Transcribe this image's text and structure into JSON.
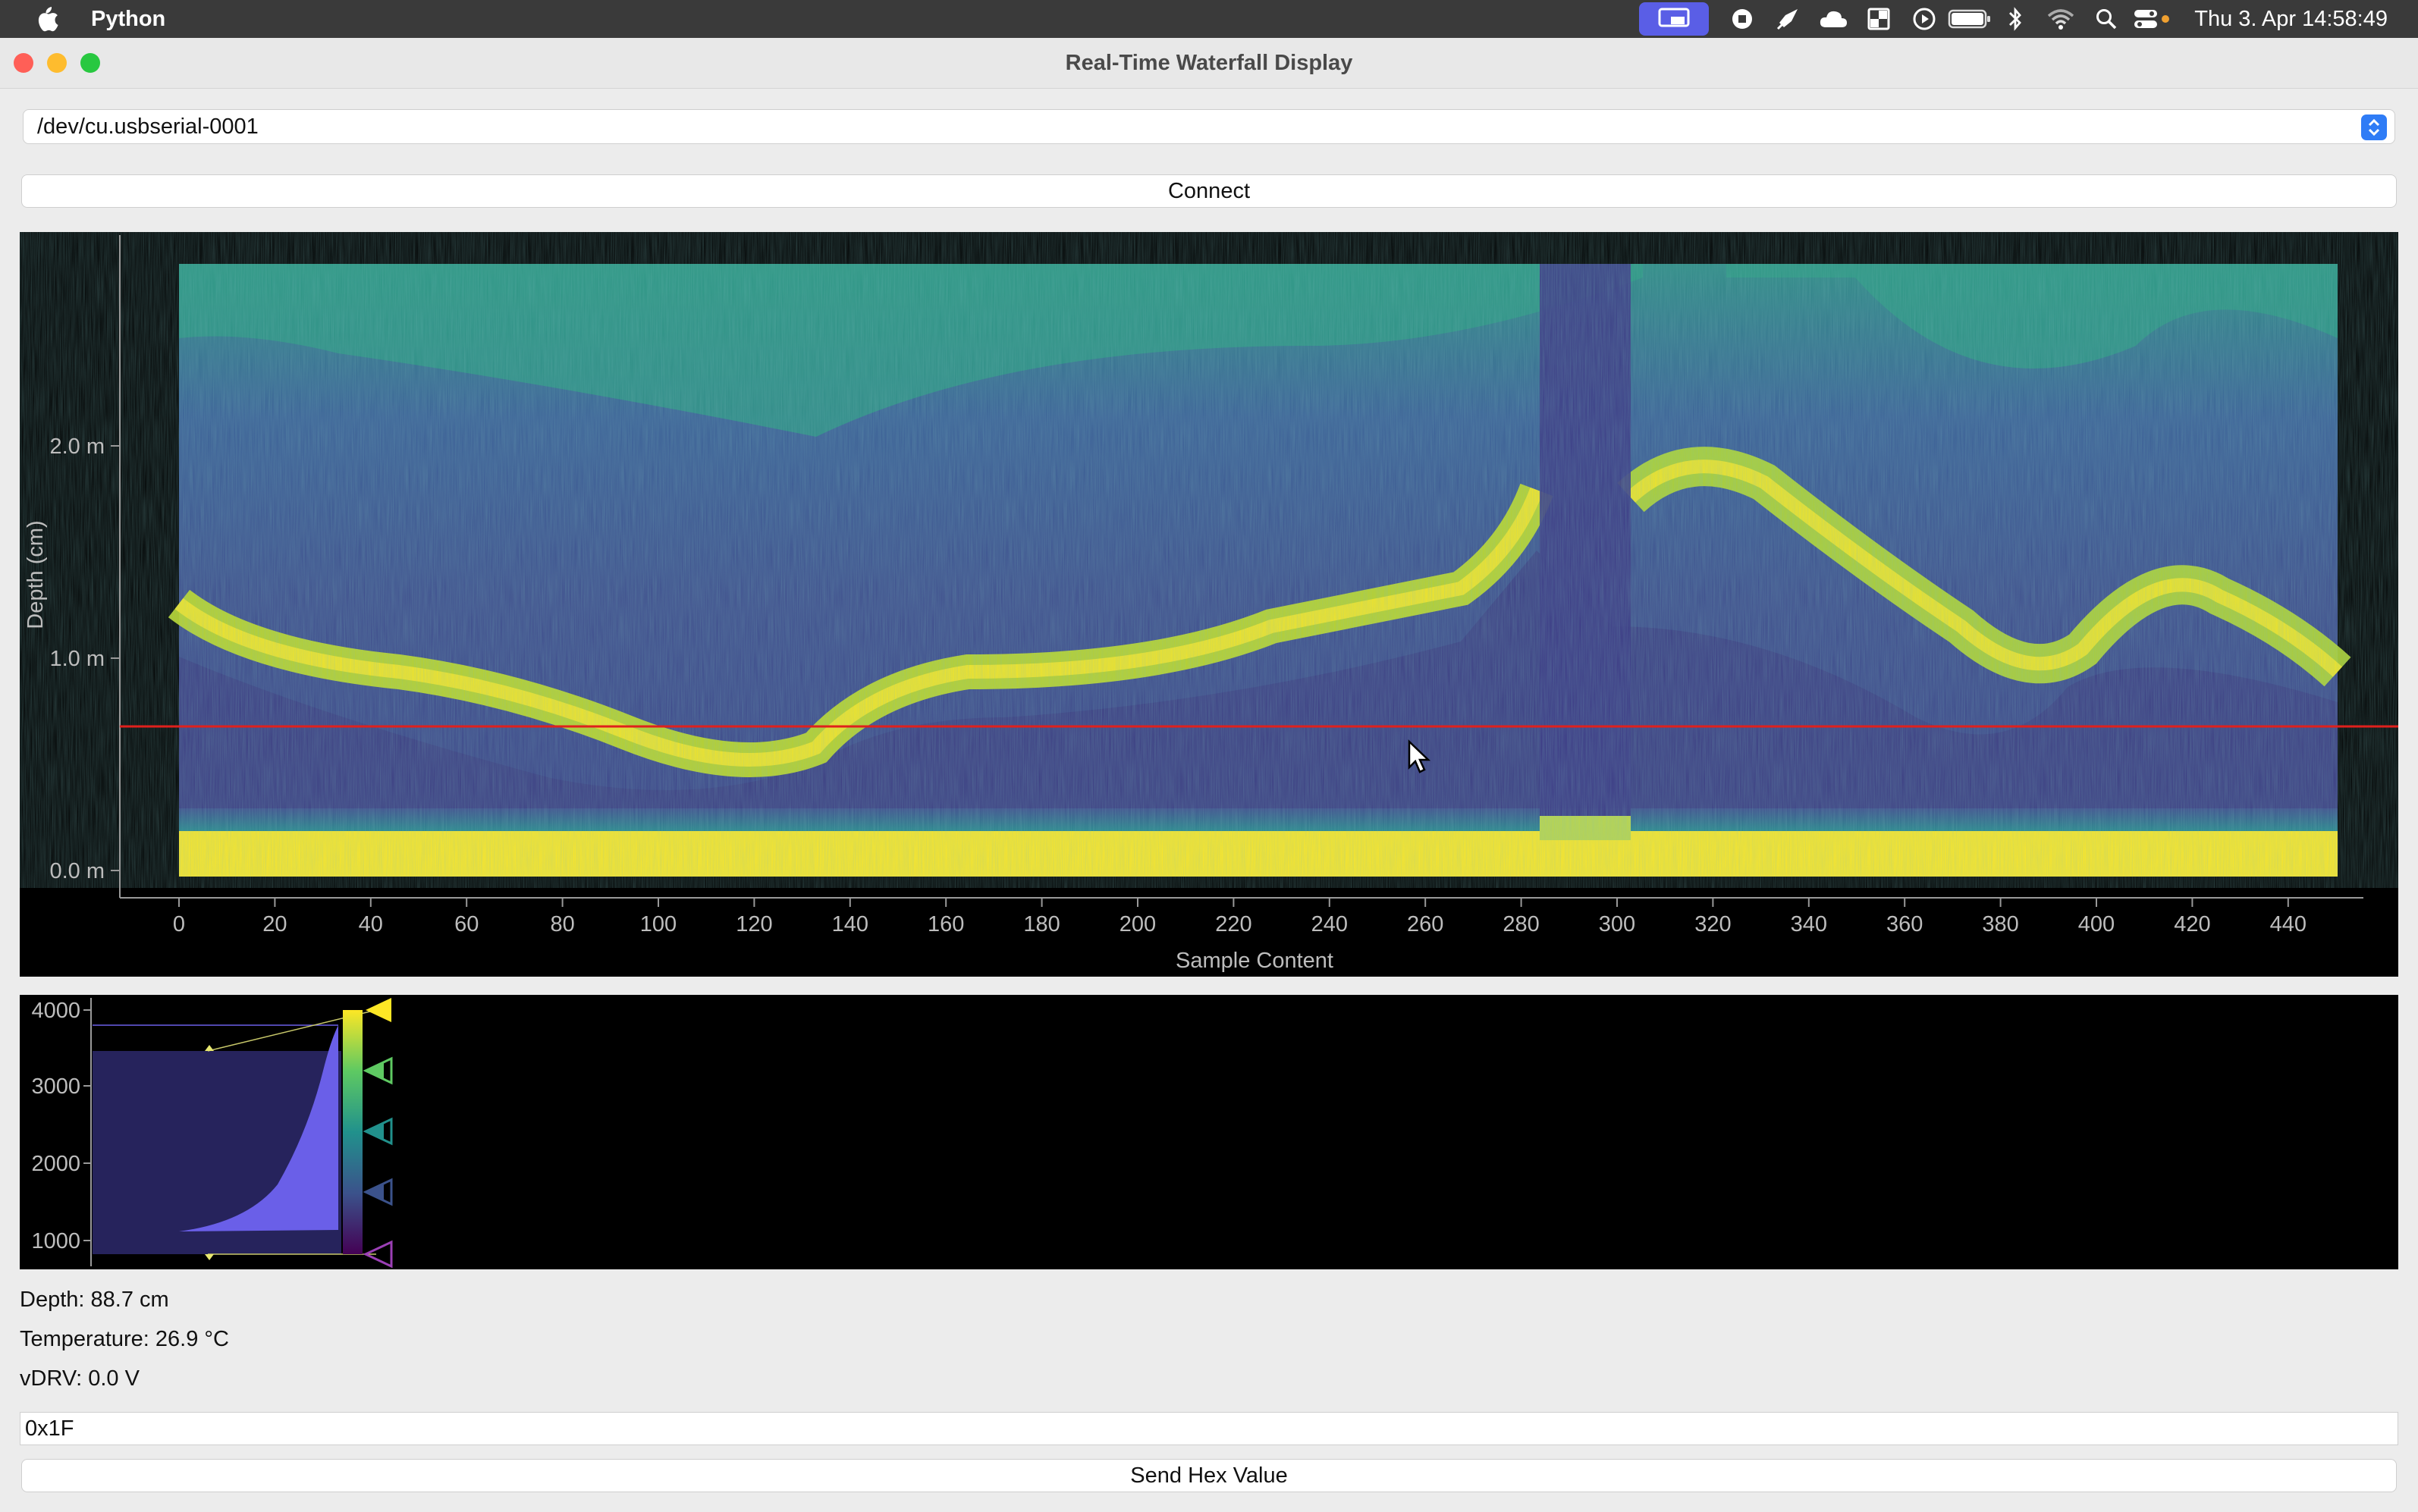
{
  "menubar": {
    "app_name": "Python",
    "clock": "Thu 3. Apr  14:58:49",
    "icons": [
      "screen-mirror-icon",
      "record-icon",
      "rocket-icon",
      "cloud-icon",
      "window-icon",
      "play-icon",
      "battery-icon",
      "bluetooth-icon",
      "wifi-icon",
      "spotlight-icon",
      "control-center-icon"
    ]
  },
  "window": {
    "title": "Real-Time Waterfall Display"
  },
  "port_select": {
    "value": "/dev/cu.usbserial-0001"
  },
  "connect_button": "Connect",
  "waterfall": {
    "y_label": "Depth (cm)",
    "x_label": "Sample Content",
    "y_ticks": [
      "0.0 m",
      "1.0 m",
      "2.0 m"
    ],
    "x_ticks": [
      "0",
      "20",
      "40",
      "60",
      "80",
      "100",
      "120",
      "140",
      "160",
      "180",
      "200",
      "220",
      "240",
      "260",
      "280",
      "300",
      "320",
      "340",
      "360",
      "380",
      "400",
      "420",
      "440"
    ],
    "cursor_depth_line_color": "#e0201c"
  },
  "histogram": {
    "y_ticks": [
      "4000",
      "3000",
      "2000",
      "1000"
    ],
    "colormap": [
      "#fde725",
      "#5ec962",
      "#21918c",
      "#3b528b",
      "#440154"
    ]
  },
  "status": {
    "depth": "Depth: 88.7 cm",
    "temperature": "Temperature: 26.9 °C",
    "vdrv": "vDRV: 0.0 V"
  },
  "hex_input": {
    "value": "0x1F"
  },
  "send_button": "Send Hex Value"
}
